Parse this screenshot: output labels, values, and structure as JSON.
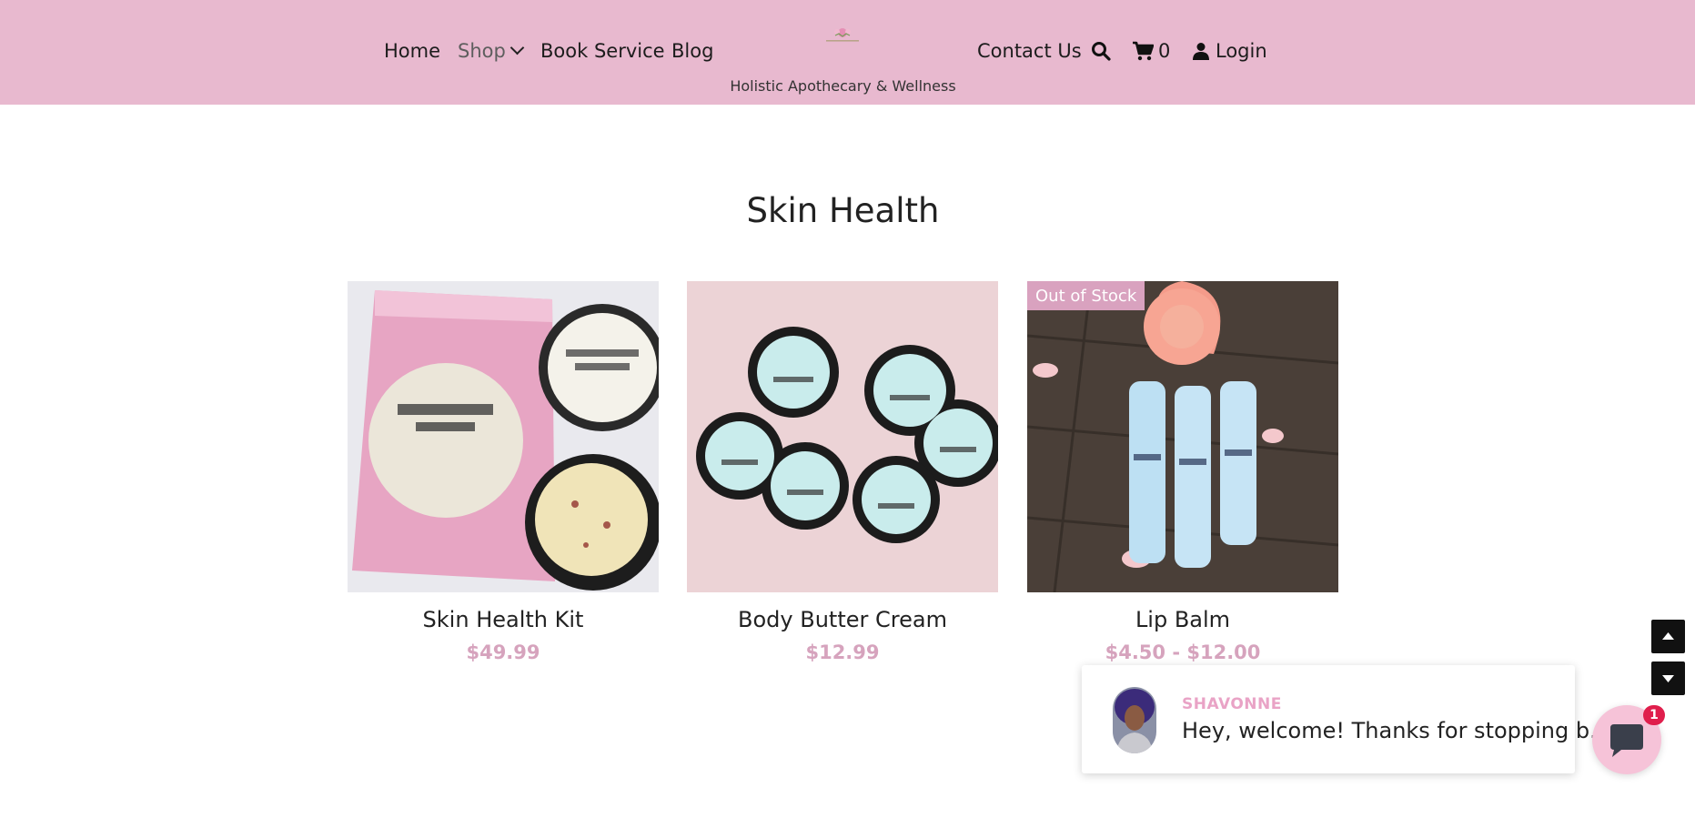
{
  "header": {
    "nav_left": [
      "Home",
      "Shop",
      "Book Service",
      "Blog"
    ],
    "nav_right": {
      "contact": "Contact Us",
      "cart_count": "0",
      "login": "Login"
    },
    "tagline": "Holistic Apothecary & Wellness",
    "icons": {
      "search": "search-icon",
      "cart": "cart-icon",
      "user": "user-icon",
      "dropdown": "chevron-down-icon"
    },
    "colors": {
      "background": "#e8b9cf"
    }
  },
  "main": {
    "title": "Skin Health",
    "products": [
      {
        "name": "Skin Health Kit",
        "price": "$49.99",
        "badge": ""
      },
      {
        "name": "Body Butter Cream",
        "price": "$12.99",
        "badge": ""
      },
      {
        "name": "Lip Balm",
        "price": "$4.50 - $12.00",
        "badge": "Out of Stock"
      }
    ],
    "colors": {
      "price": "#d6a3bd",
      "badge": "#d9a2bf"
    }
  },
  "scroll_controls": {
    "up_icon": "arrow-up-icon",
    "down_icon": "arrow-down-icon"
  },
  "chat": {
    "agent_name": "SHAVONNE",
    "message": "Hey, welcome! Thanks for stopping b...",
    "unread": "1",
    "icon": "chat-icon"
  }
}
